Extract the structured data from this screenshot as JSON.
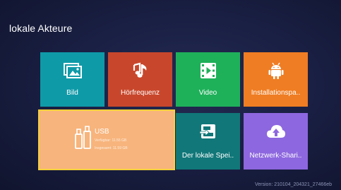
{
  "page": {
    "title": "lokale Akteure"
  },
  "tiles": [
    {
      "label": "Bild",
      "icon": "image-icon",
      "color": "#0f9aa8"
    },
    {
      "label": "Hörfrequenz",
      "icon": "music-note-icon",
      "color": "#c8472c"
    },
    {
      "label": "Video",
      "icon": "film-play-icon",
      "color": "#1fb15a"
    },
    {
      "label": "Installationspa..",
      "icon": "android-icon",
      "color": "#ef7d23"
    },
    {
      "label": "Der lokale Spei..",
      "icon": "local-storage-icon",
      "color": "#117779"
    },
    {
      "label": "Netzwerk-Shari..",
      "icon": "cloud-upload-icon",
      "color": "#8d67df"
    }
  ],
  "usb": {
    "label": "USB",
    "line1": "Verfügbar: 11.55 GB",
    "line2": "Insgesamt: 11.59 GB",
    "icon": "usb-drive-icon",
    "color": "#f7b47c",
    "focus_color": "#f5d23d"
  },
  "footer": {
    "version": "Version:  210104_204321_27466eb"
  }
}
